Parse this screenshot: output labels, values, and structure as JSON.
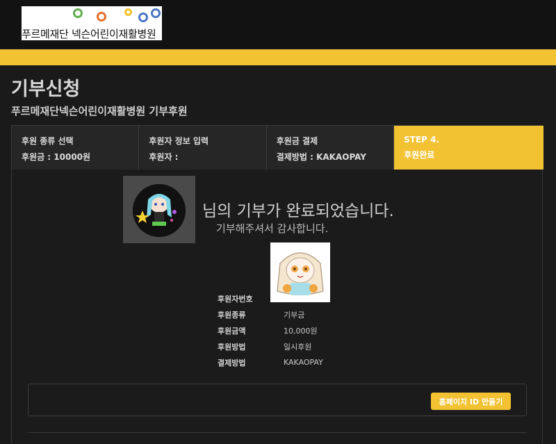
{
  "header": {
    "logo_text": "푸르메재단 넥슨어린이재활병원"
  },
  "page": {
    "title": "기부신청",
    "subtitle": "푸르메재단넥슨어린이재활병원 기부후원"
  },
  "steps": [
    {
      "title": "후원 종류 선택",
      "value": "후원금 : 10000원"
    },
    {
      "title": "후원자 정보 입력",
      "value": "후원자 :"
    },
    {
      "title": "후원금 결제",
      "value": "결제방법 : KAKAOPAY"
    },
    {
      "title": "STEP 4.",
      "value": "후원완료"
    }
  ],
  "result": {
    "done_message": "님의 기부가 완료되었습니다.",
    "thanks_message": "기부해주셔서 감사합니다."
  },
  "details": [
    {
      "label": "후원자번호",
      "value": ""
    },
    {
      "label": "후원종류",
      "value": "기부금"
    },
    {
      "label": "후원금액",
      "value": "10,000원"
    },
    {
      "label": "후원방법",
      "value": "일시후원"
    },
    {
      "label": "결제방법",
      "value": "KAKAOPAY"
    }
  ],
  "actions": {
    "create_id_label": "홈페이지 ID 만들기"
  },
  "colors": {
    "accent": "#f2c233",
    "background": "#1a1a1a"
  }
}
